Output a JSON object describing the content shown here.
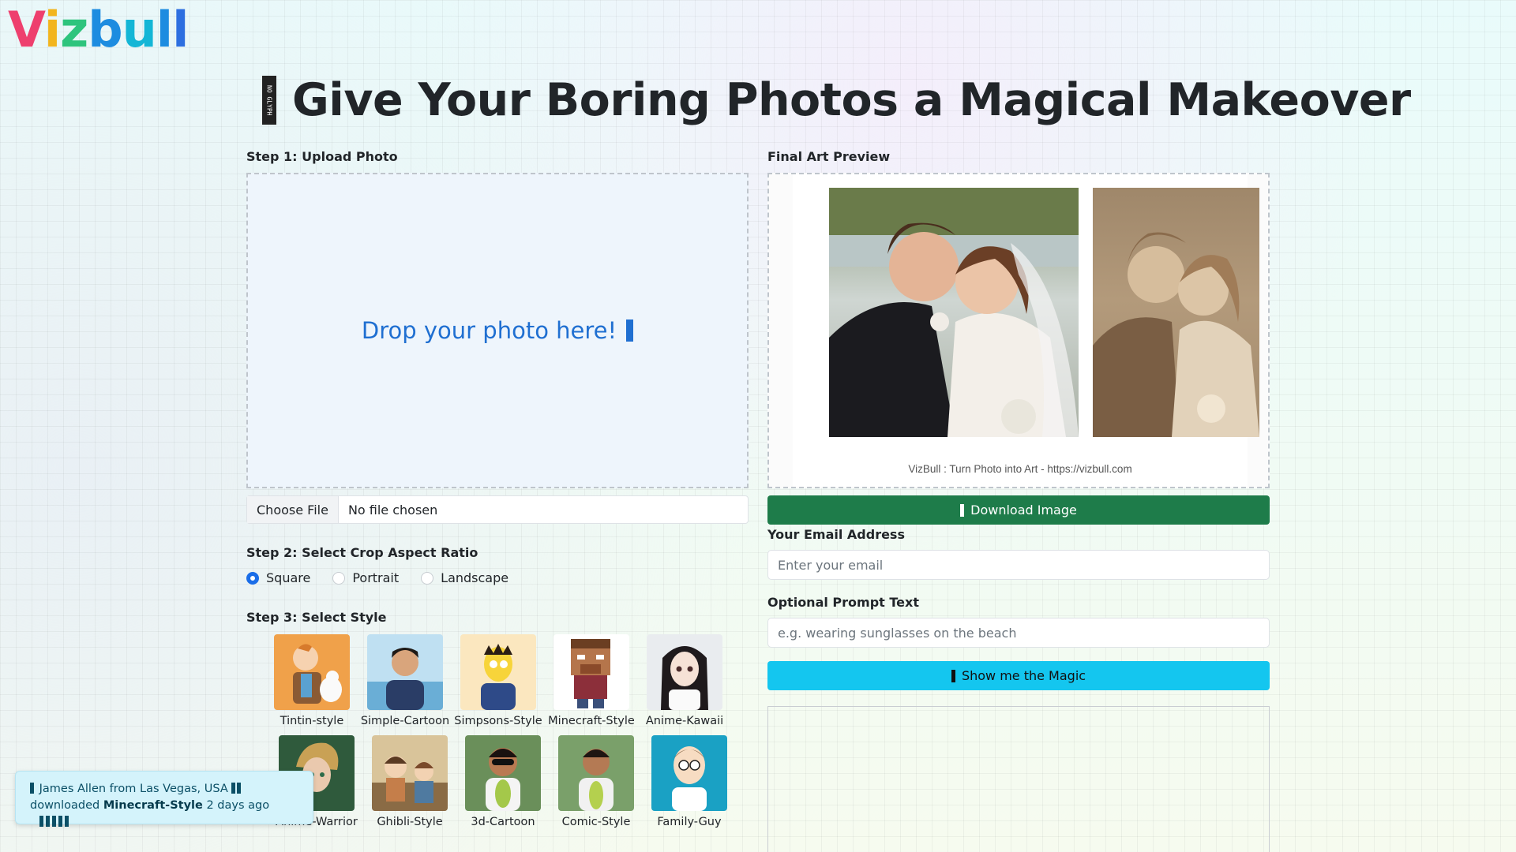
{
  "logo": {
    "parts": [
      "V",
      "i",
      "z",
      "b",
      "u",
      "l",
      "l"
    ]
  },
  "headline": {
    "icon": "no-glyph-icon",
    "icon_text": "NO GLYPH",
    "title": "Give Your Boring Photos a Magical Makeover"
  },
  "step1": {
    "label": "Step 1: Upload Photo",
    "drop_text": "Drop your photo here!",
    "file_button": "Choose File",
    "file_status": "No file chosen"
  },
  "step2": {
    "label": "Step 2: Select Crop Aspect Ratio",
    "options": [
      "Square",
      "Portrait",
      "Landscape"
    ],
    "selected": "Square"
  },
  "step3": {
    "label": "Step 3: Select Style",
    "styles_row1": [
      "Tintin-style",
      "Simple-Cartoon",
      "Simpsons-Style",
      "Minecraft-Style",
      "Anime-Kawaii"
    ],
    "styles_row2": [
      "Anime-Warrior",
      "Ghibli-Style",
      "3d-Cartoon",
      "Comic-Style",
      "Family-Guy"
    ]
  },
  "preview": {
    "label": "Final Art Preview",
    "caption": "VizBull : Turn Photo into Art - https://vizbull.com"
  },
  "download": {
    "label": "Download Image"
  },
  "email": {
    "label": "Your Email Address",
    "placeholder": "Enter your email"
  },
  "prompt": {
    "label": "Optional Prompt Text",
    "placeholder": "e.g. wearing sunglasses on the beach"
  },
  "magic": {
    "label": "Show me the Magic"
  },
  "toast": {
    "line1": "James Allen from Las Vegas, USA",
    "prefix": "downloaded",
    "style": "Minecraft-Style",
    "time": "2 days ago"
  },
  "colors": {
    "primary": "#1a6de8",
    "success": "#1e7c4a",
    "info": "#14c6ef",
    "drop_text": "#1f6fd1"
  }
}
